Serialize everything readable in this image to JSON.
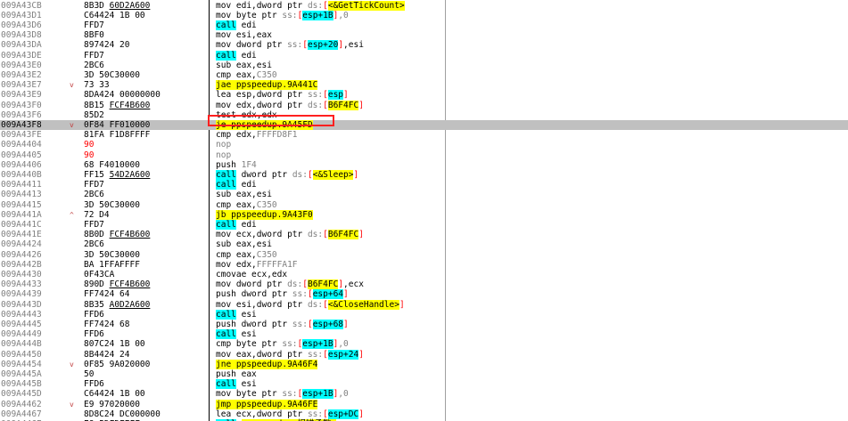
{
  "highlight_color": "#ff2020",
  "rows": [
    {
      "addr": "009A43CB",
      "arrow": "",
      "bytes": [
        [
          "8B3D ",
          false
        ],
        [
          "60D2A600",
          true
        ]
      ],
      "bytes_red": false,
      "asm": [
        [
          "mov edi,dword ptr ",
          "nm"
        ],
        [
          "ds:",
          "seg"
        ],
        [
          "[",
          "red"
        ],
        [
          "<&GetTickCount>",
          "sym"
        ]
      ],
      "gray": false,
      "current": false
    },
    {
      "addr": "009A43D1",
      "arrow": "",
      "bytes": [
        [
          "C64424 1B 00",
          false
        ]
      ],
      "bytes_red": false,
      "asm": [
        [
          "mov byte ptr ",
          "nm"
        ],
        [
          "ss:",
          "seg"
        ],
        [
          "[",
          "red"
        ],
        [
          "esp+1B",
          "call"
        ],
        [
          "]",
          "red"
        ],
        [
          ",0",
          "imm"
        ]
      ],
      "gray": false,
      "current": false
    },
    {
      "addr": "009A43D6",
      "arrow": "",
      "bytes": [
        [
          "FFD7",
          false
        ]
      ],
      "bytes_red": false,
      "asm": [
        [
          "call",
          "call"
        ],
        [
          " edi",
          "nm"
        ]
      ],
      "gray": false,
      "current": false
    },
    {
      "addr": "009A43D8",
      "arrow": "",
      "bytes": [
        [
          "8BF0",
          false
        ]
      ],
      "bytes_red": false,
      "asm": [
        [
          "mov esi,eax",
          "nm"
        ]
      ],
      "gray": false,
      "current": false
    },
    {
      "addr": "009A43DA",
      "arrow": "",
      "bytes": [
        [
          "897424 20",
          false
        ]
      ],
      "bytes_red": false,
      "asm": [
        [
          "mov dword ptr ",
          "nm"
        ],
        [
          "ss:",
          "seg"
        ],
        [
          "[",
          "red"
        ],
        [
          "esp+20",
          "call"
        ],
        [
          "]",
          "red"
        ],
        [
          ",esi",
          "nm"
        ]
      ],
      "gray": false,
      "current": false
    },
    {
      "addr": "009A43DE",
      "arrow": "",
      "bytes": [
        [
          "FFD7",
          false
        ]
      ],
      "bytes_red": false,
      "asm": [
        [
          "call",
          "call"
        ],
        [
          " edi",
          "nm"
        ]
      ],
      "gray": false,
      "current": false
    },
    {
      "addr": "009A43E0",
      "arrow": "",
      "bytes": [
        [
          "2BC6",
          false
        ]
      ],
      "bytes_red": false,
      "asm": [
        [
          "sub eax,esi",
          "nm"
        ]
      ],
      "gray": false,
      "current": false
    },
    {
      "addr": "009A43E2",
      "arrow": "",
      "bytes": [
        [
          "3D 50C30000",
          false
        ]
      ],
      "bytes_red": false,
      "asm": [
        [
          "cmp eax,",
          "nm"
        ],
        [
          "C350",
          "imm"
        ]
      ],
      "gray": false,
      "current": false
    },
    {
      "addr": "009A43E7",
      "arrow": "v",
      "bytes": [
        [
          "73 33",
          false
        ]
      ],
      "bytes_red": false,
      "asm": [
        [
          "jae ppspeedup.9A441C",
          "jmp"
        ]
      ],
      "gray": false,
      "current": false
    },
    {
      "addr": "009A43E9",
      "arrow": "",
      "bytes": [
        [
          "8DA424 00000000",
          false
        ]
      ],
      "bytes_red": false,
      "asm": [
        [
          "lea esp,dword ptr ",
          "nm"
        ],
        [
          "ss:",
          "seg"
        ],
        [
          "[",
          "red"
        ],
        [
          "esp",
          "call"
        ],
        [
          "]",
          "red"
        ]
      ],
      "gray": false,
      "current": false
    },
    {
      "addr": "009A43F0",
      "arrow": "",
      "bytes": [
        [
          "8B15 ",
          false
        ],
        [
          "FCF4B600",
          true
        ]
      ],
      "bytes_red": false,
      "asm": [
        [
          "mov edx,dword ptr ",
          "nm"
        ],
        [
          "ds:",
          "seg"
        ],
        [
          "[",
          "red"
        ],
        [
          "B6F4FC",
          "sym"
        ],
        [
          "]",
          "red"
        ]
      ],
      "gray": false,
      "current": false
    },
    {
      "addr": "009A43F6",
      "arrow": "",
      "bytes": [
        [
          "85D2",
          false
        ]
      ],
      "bytes_red": false,
      "asm": [
        [
          "test edx,edx",
          "nm"
        ]
      ],
      "gray": false,
      "current": false
    },
    {
      "addr": "009A43F8",
      "arrow": "v",
      "bytes": [
        [
          "0F84 FF010000",
          false
        ]
      ],
      "bytes_red": false,
      "asm": [
        [
          "je ppspeedup.9A45FD",
          "jmp"
        ]
      ],
      "gray": false,
      "current": true
    },
    {
      "addr": "009A43FE",
      "arrow": "",
      "bytes": [
        [
          "81FA F1D8FFFF",
          false
        ]
      ],
      "bytes_red": false,
      "asm": [
        [
          "cmp edx,",
          "nm"
        ],
        [
          "FFFFD8F1",
          "imm"
        ]
      ],
      "gray": false,
      "current": false
    },
    {
      "addr": "009A4404",
      "arrow": "",
      "bytes": [
        [
          "90",
          false
        ]
      ],
      "bytes_red": true,
      "asm": [
        [
          "nop",
          "nm"
        ]
      ],
      "gray": true,
      "current": false
    },
    {
      "addr": "009A4405",
      "arrow": "",
      "bytes": [
        [
          "90",
          false
        ]
      ],
      "bytes_red": true,
      "asm": [
        [
          "nop",
          "nm"
        ]
      ],
      "gray": true,
      "current": false
    },
    {
      "addr": "009A4406",
      "arrow": "",
      "bytes": [
        [
          "68 F4010000",
          false
        ]
      ],
      "bytes_red": false,
      "asm": [
        [
          "push ",
          "nm"
        ],
        [
          "1F4",
          "imm"
        ]
      ],
      "gray": false,
      "current": false
    },
    {
      "addr": "009A440B",
      "arrow": "",
      "bytes": [
        [
          "FF15 ",
          false
        ],
        [
          "54D2A600",
          true
        ]
      ],
      "bytes_red": false,
      "asm": [
        [
          "call",
          "call"
        ],
        [
          " dword ptr ",
          "nm"
        ],
        [
          "ds:",
          "seg"
        ],
        [
          "[",
          "red"
        ],
        [
          "<&Sleep>",
          "sym"
        ],
        [
          "]",
          "red"
        ]
      ],
      "gray": false,
      "current": false
    },
    {
      "addr": "009A4411",
      "arrow": "",
      "bytes": [
        [
          "FFD7",
          false
        ]
      ],
      "bytes_red": false,
      "asm": [
        [
          "call",
          "call"
        ],
        [
          " edi",
          "nm"
        ]
      ],
      "gray": false,
      "current": false
    },
    {
      "addr": "009A4413",
      "arrow": "",
      "bytes": [
        [
          "2BC6",
          false
        ]
      ],
      "bytes_red": false,
      "asm": [
        [
          "sub eax,esi",
          "nm"
        ]
      ],
      "gray": false,
      "current": false
    },
    {
      "addr": "009A4415",
      "arrow": "",
      "bytes": [
        [
          "3D 50C30000",
          false
        ]
      ],
      "bytes_red": false,
      "asm": [
        [
          "cmp eax,",
          "nm"
        ],
        [
          "C350",
          "imm"
        ]
      ],
      "gray": false,
      "current": false
    },
    {
      "addr": "009A441A",
      "arrow": "^",
      "bytes": [
        [
          "72 D4",
          false
        ]
      ],
      "bytes_red": false,
      "asm": [
        [
          "jb ppspeedup.9A43F0",
          "jmp"
        ]
      ],
      "gray": false,
      "current": false
    },
    {
      "addr": "009A441C",
      "arrow": "",
      "bytes": [
        [
          "FFD7",
          false
        ]
      ],
      "bytes_red": false,
      "asm": [
        [
          "call",
          "call"
        ],
        [
          " edi",
          "nm"
        ]
      ],
      "gray": false,
      "current": false
    },
    {
      "addr": "009A441E",
      "arrow": "",
      "bytes": [
        [
          "8B0D ",
          false
        ],
        [
          "FCF4B600",
          true
        ]
      ],
      "bytes_red": false,
      "asm": [
        [
          "mov ecx,dword ptr ",
          "nm"
        ],
        [
          "ds:",
          "seg"
        ],
        [
          "[",
          "red"
        ],
        [
          "B6F4FC",
          "sym"
        ],
        [
          "]",
          "red"
        ]
      ],
      "gray": false,
      "current": false
    },
    {
      "addr": "009A4424",
      "arrow": "",
      "bytes": [
        [
          "2BC6",
          false
        ]
      ],
      "bytes_red": false,
      "asm": [
        [
          "sub eax,esi",
          "nm"
        ]
      ],
      "gray": false,
      "current": false
    },
    {
      "addr": "009A4426",
      "arrow": "",
      "bytes": [
        [
          "3D 50C30000",
          false
        ]
      ],
      "bytes_red": false,
      "asm": [
        [
          "cmp eax,",
          "nm"
        ],
        [
          "C350",
          "imm"
        ]
      ],
      "gray": false,
      "current": false
    },
    {
      "addr": "009A442B",
      "arrow": "",
      "bytes": [
        [
          "BA 1FFAFFFF",
          false
        ]
      ],
      "bytes_red": false,
      "asm": [
        [
          "mov edx,",
          "nm"
        ],
        [
          "FFFFFA1F",
          "imm"
        ]
      ],
      "gray": false,
      "current": false
    },
    {
      "addr": "009A4430",
      "arrow": "",
      "bytes": [
        [
          "0F43CA",
          false
        ]
      ],
      "bytes_red": false,
      "asm": [
        [
          "cmovae ecx,edx",
          "nm"
        ]
      ],
      "gray": false,
      "current": false
    },
    {
      "addr": "009A4433",
      "arrow": "",
      "bytes": [
        [
          "890D ",
          false
        ],
        [
          "FCF4B600",
          true
        ]
      ],
      "bytes_red": false,
      "asm": [
        [
          "mov dword ptr ",
          "nm"
        ],
        [
          "ds:",
          "seg"
        ],
        [
          "[",
          "red"
        ],
        [
          "B6F4FC",
          "sym"
        ],
        [
          "]",
          "red"
        ],
        [
          ",ecx",
          "nm"
        ]
      ],
      "gray": false,
      "current": false
    },
    {
      "addr": "009A4439",
      "arrow": "",
      "bytes": [
        [
          "FF7424 64",
          false
        ]
      ],
      "bytes_red": false,
      "asm": [
        [
          "push dword ptr ",
          "nm"
        ],
        [
          "ss:",
          "seg"
        ],
        [
          "[",
          "red"
        ],
        [
          "esp+64",
          "call"
        ],
        [
          "]",
          "red"
        ]
      ],
      "gray": false,
      "current": false
    },
    {
      "addr": "009A443D",
      "arrow": "",
      "bytes": [
        [
          "8B35 ",
          false
        ],
        [
          "A0D2A600",
          true
        ]
      ],
      "bytes_red": false,
      "asm": [
        [
          "mov esi,dword ptr ",
          "nm"
        ],
        [
          "ds:",
          "seg"
        ],
        [
          "[",
          "red"
        ],
        [
          "<&CloseHandle>",
          "sym"
        ],
        [
          "]",
          "red"
        ]
      ],
      "gray": false,
      "current": false
    },
    {
      "addr": "009A4443",
      "arrow": "",
      "bytes": [
        [
          "FFD6",
          false
        ]
      ],
      "bytes_red": false,
      "asm": [
        [
          "call",
          "call"
        ],
        [
          " esi",
          "nm"
        ]
      ],
      "gray": false,
      "current": false
    },
    {
      "addr": "009A4445",
      "arrow": "",
      "bytes": [
        [
          "FF7424 68",
          false
        ]
      ],
      "bytes_red": false,
      "asm": [
        [
          "push dword ptr ",
          "nm"
        ],
        [
          "ss:",
          "seg"
        ],
        [
          "[",
          "red"
        ],
        [
          "esp+68",
          "call"
        ],
        [
          "]",
          "red"
        ]
      ],
      "gray": false,
      "current": false
    },
    {
      "addr": "009A4449",
      "arrow": "",
      "bytes": [
        [
          "FFD6",
          false
        ]
      ],
      "bytes_red": false,
      "asm": [
        [
          "call",
          "call"
        ],
        [
          " esi",
          "nm"
        ]
      ],
      "gray": false,
      "current": false
    },
    {
      "addr": "009A444B",
      "arrow": "",
      "bytes": [
        [
          "807C24 1B 00",
          false
        ]
      ],
      "bytes_red": false,
      "asm": [
        [
          "cmp byte ptr ",
          "nm"
        ],
        [
          "ss:",
          "seg"
        ],
        [
          "[",
          "red"
        ],
        [
          "esp+1B",
          "call"
        ],
        [
          "]",
          "red"
        ],
        [
          ",0",
          "imm"
        ]
      ],
      "gray": false,
      "current": false
    },
    {
      "addr": "009A4450",
      "arrow": "",
      "bytes": [
        [
          "8B4424 24",
          false
        ]
      ],
      "bytes_red": false,
      "asm": [
        [
          "mov eax,dword ptr ",
          "nm"
        ],
        [
          "ss:",
          "seg"
        ],
        [
          "[",
          "red"
        ],
        [
          "esp+24",
          "call"
        ],
        [
          "]",
          "red"
        ]
      ],
      "gray": false,
      "current": false
    },
    {
      "addr": "009A4454",
      "arrow": "v",
      "bytes": [
        [
          "0F85 9A020000",
          false
        ]
      ],
      "bytes_red": false,
      "asm": [
        [
          "jne ppspeedup.9A46F4",
          "jmp"
        ]
      ],
      "gray": false,
      "current": false
    },
    {
      "addr": "009A445A",
      "arrow": "",
      "bytes": [
        [
          "50",
          false
        ]
      ],
      "bytes_red": false,
      "asm": [
        [
          "push eax",
          "nm"
        ]
      ],
      "gray": false,
      "current": false
    },
    {
      "addr": "009A445B",
      "arrow": "",
      "bytes": [
        [
          "FFD6",
          false
        ]
      ],
      "bytes_red": false,
      "asm": [
        [
          "call",
          "call"
        ],
        [
          " esi",
          "nm"
        ]
      ],
      "gray": false,
      "current": false
    },
    {
      "addr": "009A445D",
      "arrow": "",
      "bytes": [
        [
          "C64424 1B 00",
          false
        ]
      ],
      "bytes_red": false,
      "asm": [
        [
          "mov byte ptr ",
          "nm"
        ],
        [
          "ss:",
          "seg"
        ],
        [
          "[",
          "red"
        ],
        [
          "esp+1B",
          "call"
        ],
        [
          "]",
          "red"
        ],
        [
          ",0",
          "imm"
        ]
      ],
      "gray": false,
      "current": false
    },
    {
      "addr": "009A4462",
      "arrow": "v",
      "bytes": [
        [
          "E9 97020000",
          false
        ]
      ],
      "bytes_red": false,
      "asm": [
        [
          "jmp ppspeedup.9A46FE",
          "jmp"
        ]
      ],
      "gray": false,
      "current": false
    },
    {
      "addr": "009A4467",
      "arrow": "",
      "bytes": [
        [
          "8D8C24 DC000000",
          false
        ]
      ],
      "bytes_red": false,
      "asm": [
        [
          "lea ecx,dword ptr ",
          "nm"
        ],
        [
          "ss:",
          "seg"
        ],
        [
          "[",
          "red"
        ],
        [
          "esp+DC",
          "call"
        ],
        [
          "]",
          "red"
        ]
      ],
      "gray": false,
      "current": false
    },
    {
      "addr": "009A446E",
      "arrow": "",
      "bytes": [
        [
          "E8 5DFDFEFF",
          false
        ]
      ],
      "bytes_red": false,
      "asm": [
        [
          "call",
          "call"
        ],
        [
          " ",
          "nm"
        ],
        [
          "<ppspeedup.报错函数>",
          "sym"
        ]
      ],
      "gray": false,
      "current": false
    }
  ]
}
